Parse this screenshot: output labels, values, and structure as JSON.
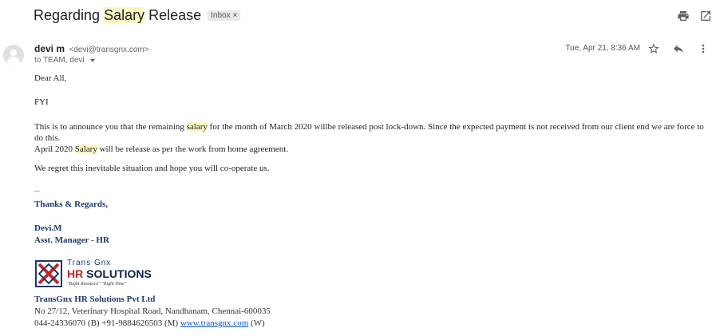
{
  "email": {
    "subject_before": "Regarding ",
    "subject_highlight": "Salary",
    "subject_after": " Release",
    "label_chip": "Inbox",
    "chip_close": "×",
    "sender_name": "devi m",
    "sender_email": "<devi@transgnx.com>",
    "recipients": "to TEAM, devi",
    "date": "Tue, Apr 21, 8:36 AM"
  },
  "body": {
    "greeting": "Dear All,",
    "fyi": "FYI",
    "para1_before": "This is to announce you that the remaining ",
    "para1_highlight": "salary",
    "para1_after": " for the month of March 2020 willbe released post lock-down. Since the expected payment is not received from our client end we are force to do this.",
    "para2_before": "April 2020 ",
    "para2_highlight": "Salary",
    "para2_after": " will be release as per the work from home agreement.",
    "para3": "We regret this inevitable situation and hope you will co-operate us."
  },
  "signature": {
    "dashes": "--",
    "thanks": "Thanks & Regards,",
    "name": "Devi.M",
    "title": "Asst. Manager - HR",
    "logo_top": "Trans Gnx",
    "logo_hr": "HR",
    "logo_solutions": " SOLUTIONS",
    "logo_tagline": "\"Right Resource\" \"Right Time\"",
    "company": "TransGnx HR Solutions Pvt Ltd",
    "address": "No 27/12, Veterinary Hospital Road, Nandhanam, Chennai-600035",
    "phone_before": "044-24336070 (B)  +91-9884626503 (M)  ",
    "website": "www.transgnx.com",
    "phone_after": " (W)"
  },
  "icons": {
    "print": "print-icon",
    "open_new": "open-in-new-icon",
    "star": "star-icon",
    "reply": "reply-icon",
    "more": "more-vert-icon"
  },
  "colors": {
    "highlight": "#fcf8c4",
    "signature_navy": "#1f3864",
    "logo_red": "#c0272d",
    "link": "#1155cc"
  }
}
